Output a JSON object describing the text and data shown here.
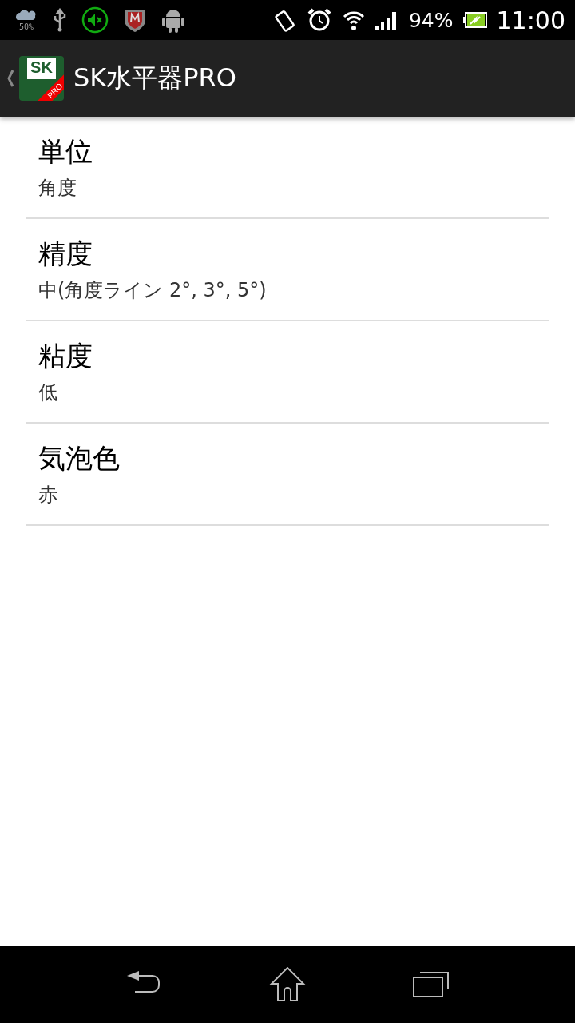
{
  "status_bar": {
    "weather_text": "50%",
    "battery": "94%",
    "time": "11:00"
  },
  "action_bar": {
    "logo_text": "SK",
    "logo_badge": "PRO",
    "title": "SK水平器PRO"
  },
  "settings": [
    {
      "title": "単位",
      "summary": "角度"
    },
    {
      "title": "精度",
      "summary": "中(角度ライン 2°, 3°, 5°)"
    },
    {
      "title": "粘度",
      "summary": "低"
    },
    {
      "title": "気泡色",
      "summary": "赤"
    }
  ]
}
